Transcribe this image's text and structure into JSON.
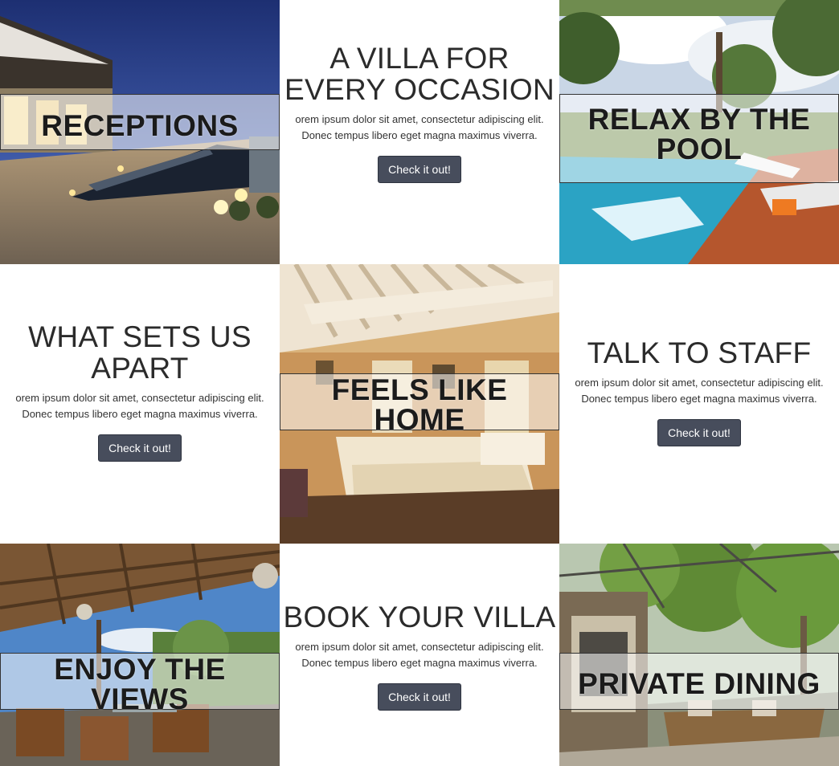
{
  "tiles": {
    "receptions": {
      "title": "RECEPTIONS"
    },
    "villa": {
      "title_line1": "A VILLA FOR",
      "title_line2": "EVERY OCCASION",
      "text_line1": "orem ipsum dolor sit amet, consectetur adipiscing elit.",
      "text_line2": "Donec tempus libero eget magna maximus viverra.",
      "button": "Check it out!"
    },
    "pool": {
      "title_line1": "RELAX BY THE",
      "title_line2": "POOL"
    },
    "apart": {
      "title_line1": "WHAT SETS US",
      "title_line2": "APART",
      "text_line1": "orem ipsum dolor sit amet, consectetur adipiscing elit.",
      "text_line2": "Donec tempus libero eget magna maximus viverra.",
      "button": "Check it out!"
    },
    "home": {
      "title": "FEELS LIKE HOME"
    },
    "staff": {
      "title": "TALK TO STAFF",
      "text_line1": "orem ipsum dolor sit amet, consectetur adipiscing elit.",
      "text_line2": "Donec tempus libero eget magna maximus viverra.",
      "button": "Check it out!"
    },
    "views": {
      "title": "ENJOY THE VIEWS"
    },
    "book": {
      "title": "BOOK YOUR VILLA",
      "text_line1": "orem ipsum dolor sit amet, consectetur adipiscing elit.",
      "text_line2": "Donec tempus libero eget magna maximus viverra.",
      "button": "Check it out!"
    },
    "dining": {
      "title": "PRIVATE DINING"
    }
  },
  "colors": {
    "button_bg": "#474d5c",
    "banner_overlay": "rgba(255,255,255,0.55)",
    "heading_text": "#2b2b2b"
  }
}
